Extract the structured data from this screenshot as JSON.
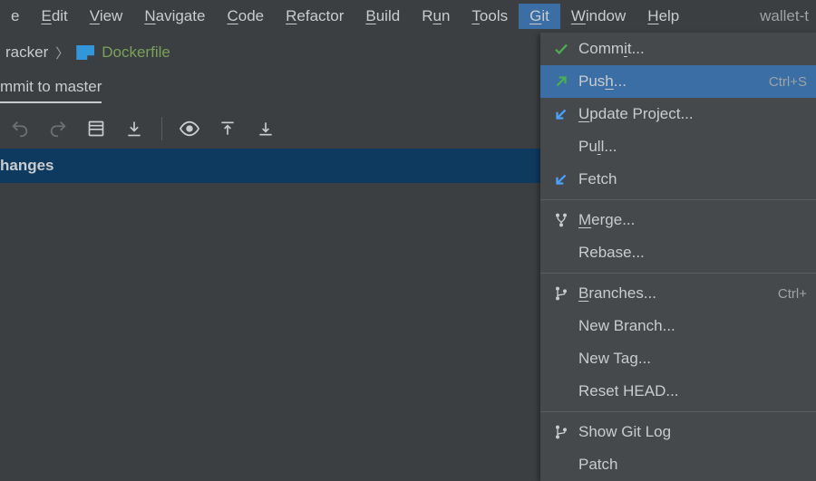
{
  "menubar": {
    "items": [
      {
        "pre": "",
        "mn": "",
        "post": "e"
      },
      {
        "pre": "",
        "mn": "E",
        "post": "dit"
      },
      {
        "pre": "",
        "mn": "V",
        "post": "iew"
      },
      {
        "pre": "",
        "mn": "N",
        "post": "avigate"
      },
      {
        "pre": "",
        "mn": "C",
        "post": "ode"
      },
      {
        "pre": "",
        "mn": "R",
        "post": "efactor"
      },
      {
        "pre": "",
        "mn": "B",
        "post": "uild"
      },
      {
        "pre": "R",
        "mn": "u",
        "post": "n"
      },
      {
        "pre": "",
        "mn": "T",
        "post": "ools"
      },
      {
        "pre": "",
        "mn": "G",
        "post": "it"
      },
      {
        "pre": "",
        "mn": "W",
        "post": "indow"
      },
      {
        "pre": "",
        "mn": "H",
        "post": "elp"
      }
    ],
    "active_index": 9,
    "project_label": "wallet-t"
  },
  "breadcrumb": {
    "crumb0": "racker",
    "file": "Dockerfile"
  },
  "tabs": {
    "active_label": "mmit to master"
  },
  "panel": {
    "changes_label": "hanges"
  },
  "git_menu": {
    "items": [
      {
        "icon": "check",
        "pre": "Comm",
        "mn": "i",
        "post": "t...",
        "shortcut": ""
      },
      {
        "icon": "arrow-up",
        "pre": "Pus",
        "mn": "h",
        "post": "...",
        "shortcut": "Ctrl+S",
        "hl": true
      },
      {
        "icon": "arrow-down",
        "pre": "",
        "mn": "U",
        "post": "pdate Project...",
        "shortcut": ""
      },
      {
        "icon": "",
        "pre": "Pu",
        "mn": "l",
        "post": "l...",
        "shortcut": ""
      },
      {
        "icon": "arrow-down",
        "pre": "Fetch",
        "mn": "",
        "post": "",
        "shortcut": ""
      },
      {
        "sep": true
      },
      {
        "icon": "merge",
        "pre": "",
        "mn": "M",
        "post": "erge...",
        "shortcut": ""
      },
      {
        "icon": "",
        "pre": "Rebase...",
        "mn": "",
        "post": "",
        "shortcut": ""
      },
      {
        "sep": true
      },
      {
        "icon": "branch",
        "pre": "",
        "mn": "B",
        "post": "ranches...",
        "shortcut": "Ctrl+"
      },
      {
        "icon": "",
        "pre": "New Branch...",
        "mn": "",
        "post": "",
        "shortcut": ""
      },
      {
        "icon": "",
        "pre": "New Tag...",
        "mn": "",
        "post": "",
        "shortcut": ""
      },
      {
        "icon": "",
        "pre": "Reset HEAD...",
        "mn": "",
        "post": "",
        "shortcut": ""
      },
      {
        "sep": true
      },
      {
        "icon": "branch",
        "pre": "Show Git Log",
        "mn": "",
        "post": "",
        "shortcut": ""
      },
      {
        "icon": "",
        "pre": "Patch",
        "mn": "",
        "post": "",
        "shortcut": ""
      }
    ]
  }
}
